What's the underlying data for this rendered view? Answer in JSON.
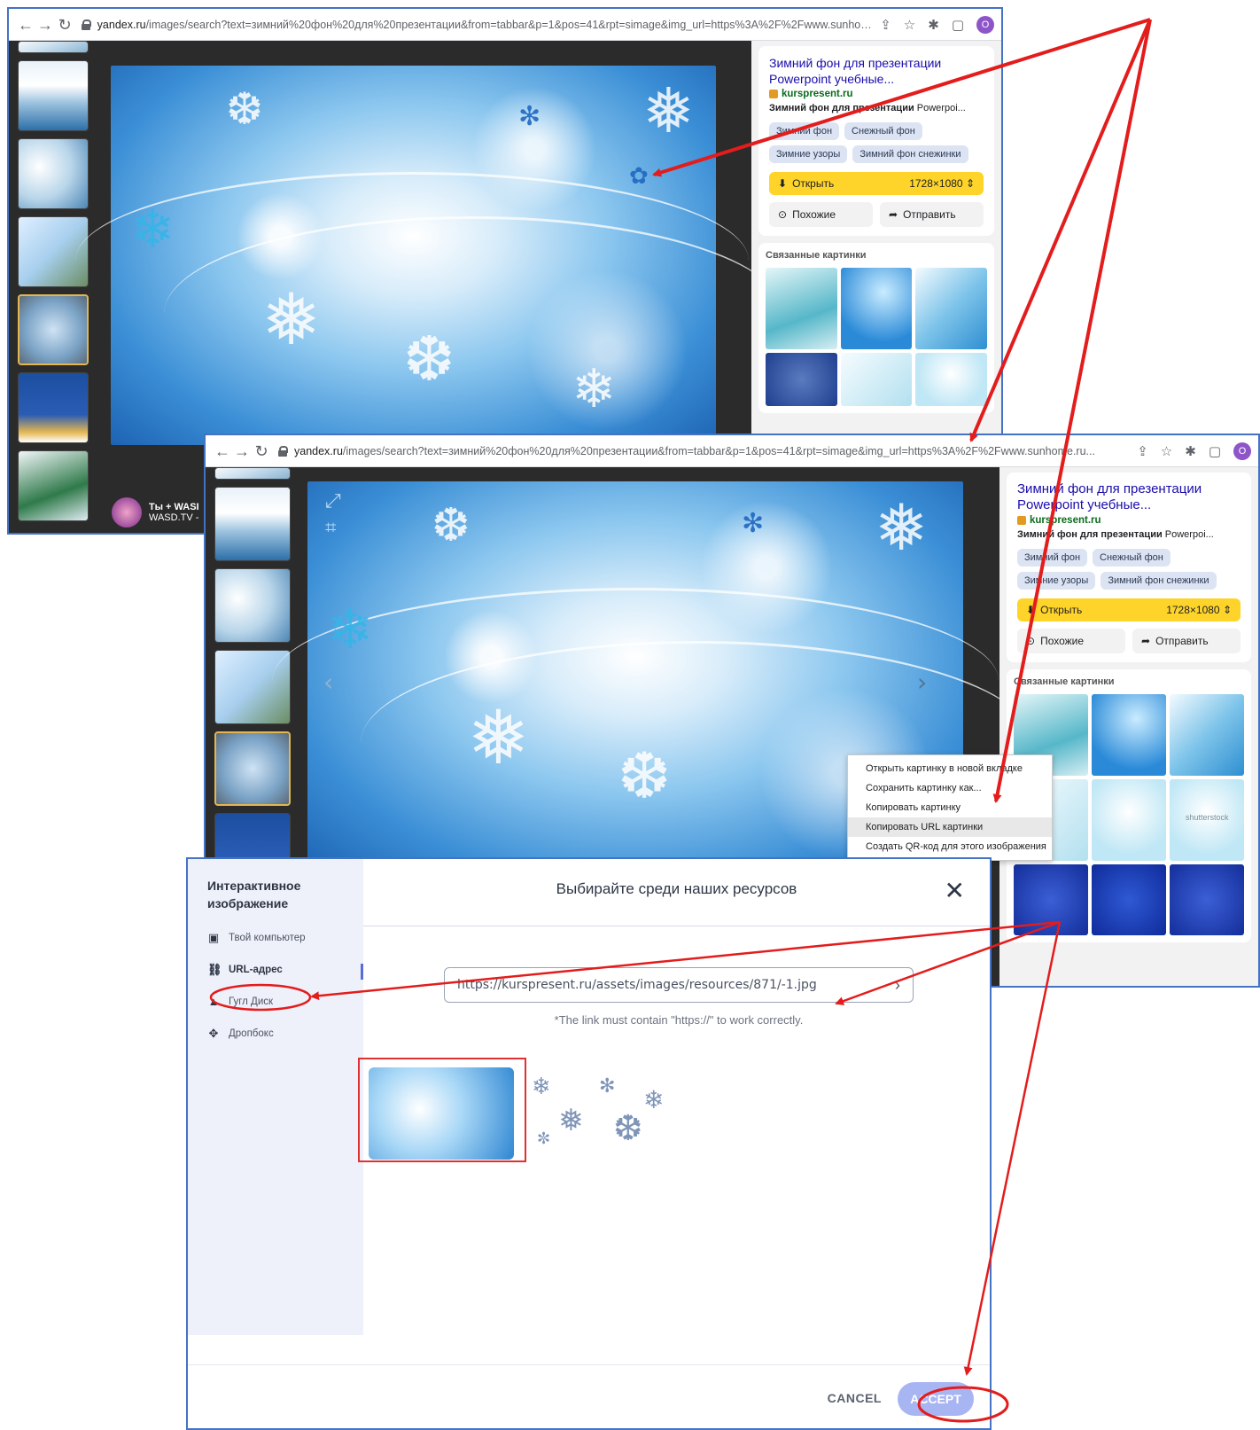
{
  "browser1": {
    "url_domain": "yandex.ru",
    "url_path": "/images/search?text=зимний%20фон%20для%20презентации&from=tabbar&p=1&pos=41&rpt=simage&img_url=https%3A%2F%2Fwww.sunhome.ru...",
    "profile_initial": "O"
  },
  "browser2": {
    "url_domain": "yandex.ru",
    "url_path": "/images/search?text=зимний%20фон%20для%20презентации&from=tabbar&p=1&pos=41&rpt=simage&img_url=https%3A%2F%2Fwww.sunhome.ru...",
    "profile_initial": "O"
  },
  "panel": {
    "title": "Зимний фон для презентации Powerpoint учебные...",
    "site": "kurspresent.ru",
    "desc_bold": "Зимний фон для презентации",
    "desc_rest": " Powerpoi...",
    "tags": [
      "Зимний фон",
      "Снежный фон",
      "Зимние узоры",
      "Зимний фон снежинки"
    ],
    "open_label": "Открыть",
    "size": "1728×1080",
    "similar_label": "Похожие",
    "send_label": "Отправить",
    "related_heading": "Связанные картинки"
  },
  "ad": {
    "line1": "Ты + WASI",
    "line2": "WASD.TV -"
  },
  "watermark": "shutterstock",
  "context_menu": [
    "Открыть картинку в новой вкладке",
    "Сохранить картинку как...",
    "Копировать картинку",
    "Копировать URL картинки",
    "Создать QR-код для этого изображения"
  ],
  "modal": {
    "sidebar_title": "Интерактивное изображение",
    "sources": [
      "Твой компьютер",
      "URL-адрес",
      "Гугл Диск",
      "Дропбокс"
    ],
    "heading": "Выбирайте среди наших ресурсов",
    "url_value": "https://kurspresent.ru/assets/images/resources/871/-1.jpg",
    "hint": "*The link must contain \"https://\" to work correctly.",
    "cancel": "CANCEL",
    "accept": "ACCEPT"
  },
  "colors": {
    "annotation": "#e31c1c",
    "window_border": "#4472c4",
    "accent_yellow": "#fed42b"
  }
}
